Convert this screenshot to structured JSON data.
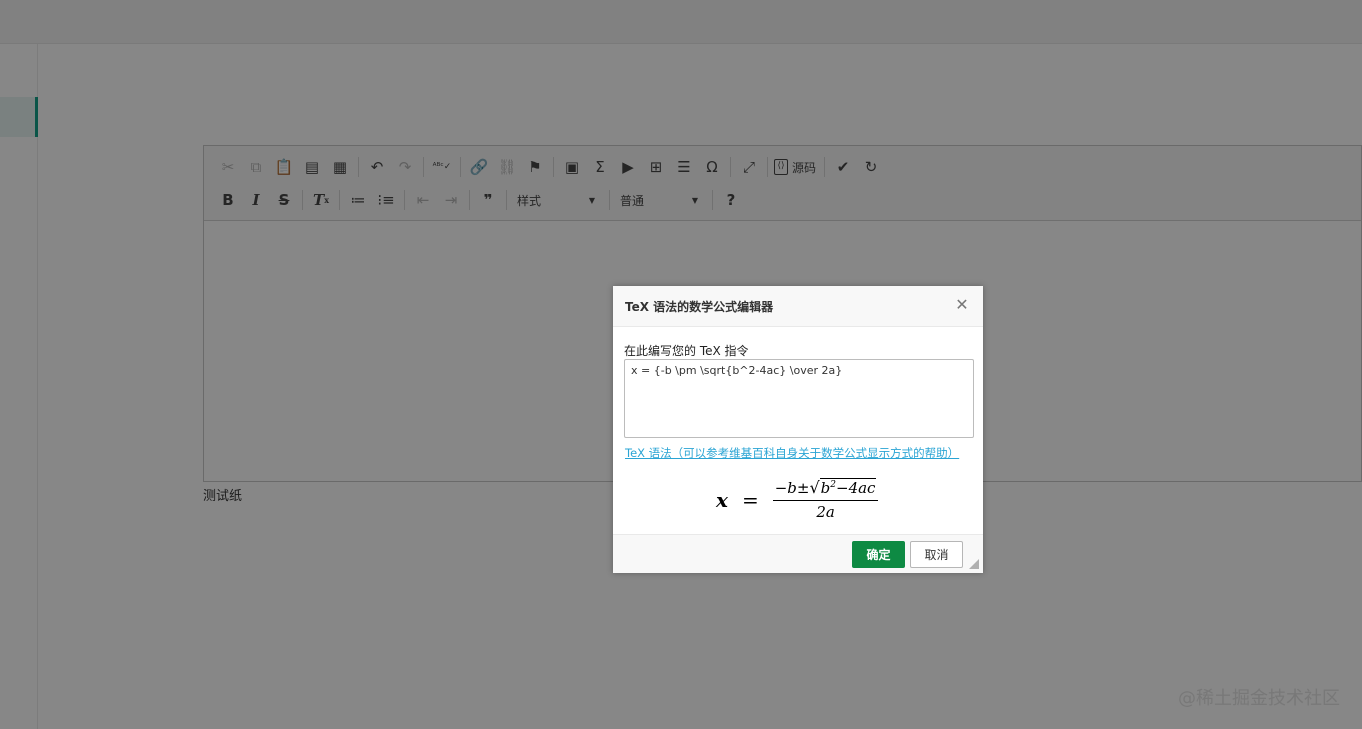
{
  "editor": {
    "toolbar_row1": [
      {
        "icon": "cut-icon",
        "glyph": "✂",
        "disabled": true
      },
      {
        "icon": "copy-icon",
        "glyph": "⧉",
        "disabled": true
      },
      {
        "icon": "paste-icon",
        "glyph": "📋",
        "disabled": false
      },
      {
        "icon": "paste-text-icon",
        "glyph": "▤",
        "disabled": false
      },
      {
        "icon": "paste-word-icon",
        "glyph": "▦",
        "disabled": false
      },
      {
        "sep": true
      },
      {
        "icon": "undo-icon",
        "glyph": "↶",
        "disabled": false
      },
      {
        "icon": "redo-icon",
        "glyph": "↷",
        "disabled": true
      },
      {
        "sep": true
      },
      {
        "icon": "spellcheck-icon",
        "glyph": "ᴬᴮᶜ✓",
        "disabled": false
      },
      {
        "sep": true
      },
      {
        "icon": "link-icon",
        "glyph": "🔗",
        "disabled": false
      },
      {
        "icon": "unlink-icon",
        "glyph": "⛓",
        "disabled": true
      },
      {
        "icon": "anchor-flag-icon",
        "glyph": "⚑",
        "disabled": false
      },
      {
        "sep": true
      },
      {
        "icon": "image-icon",
        "glyph": "▣",
        "disabled": false
      },
      {
        "icon": "sigma-icon",
        "glyph": "Σ",
        "disabled": false
      },
      {
        "icon": "video-icon",
        "glyph": "▶",
        "disabled": false
      },
      {
        "icon": "table-icon",
        "glyph": "⊞",
        "disabled": false
      },
      {
        "icon": "horizontal-rule-icon",
        "glyph": "☰",
        "disabled": false
      },
      {
        "icon": "special-char-icon",
        "glyph": "Ω",
        "disabled": false
      },
      {
        "sep": true
      },
      {
        "icon": "maximize-icon",
        "glyph": "⤢",
        "disabled": false
      },
      {
        "sep": true
      },
      {
        "source": true
      },
      {
        "sep": true
      },
      {
        "icon": "check-icon",
        "glyph": "✔",
        "disabled": false
      },
      {
        "icon": "refresh-icon",
        "glyph": "↻",
        "disabled": false
      }
    ],
    "source_label": "源码",
    "style_combo": "样式",
    "format_combo": "普通",
    "label": "测试纸"
  },
  "dialog": {
    "title": "TeX 语法的数学公式编辑器",
    "prompt": "在此编写您的 TeX 指令",
    "tex_value": "x = {-b \\pm \\sqrt{b^2-4ac} \\over 2a}",
    "help_link": "TeX 语法（可以参考维基百科自身关于数学公式显示方式的帮助）",
    "preview": {
      "lhs": "x",
      "eq": "=",
      "num_prefix": "−b±",
      "sqrt_body": "b",
      "sqrt_sup": "2",
      "sqrt_rest": "−4ac",
      "den": "2a"
    },
    "ok_label": "确定",
    "cancel_label": "取消"
  },
  "watermark": "@稀土掘金技术社区"
}
